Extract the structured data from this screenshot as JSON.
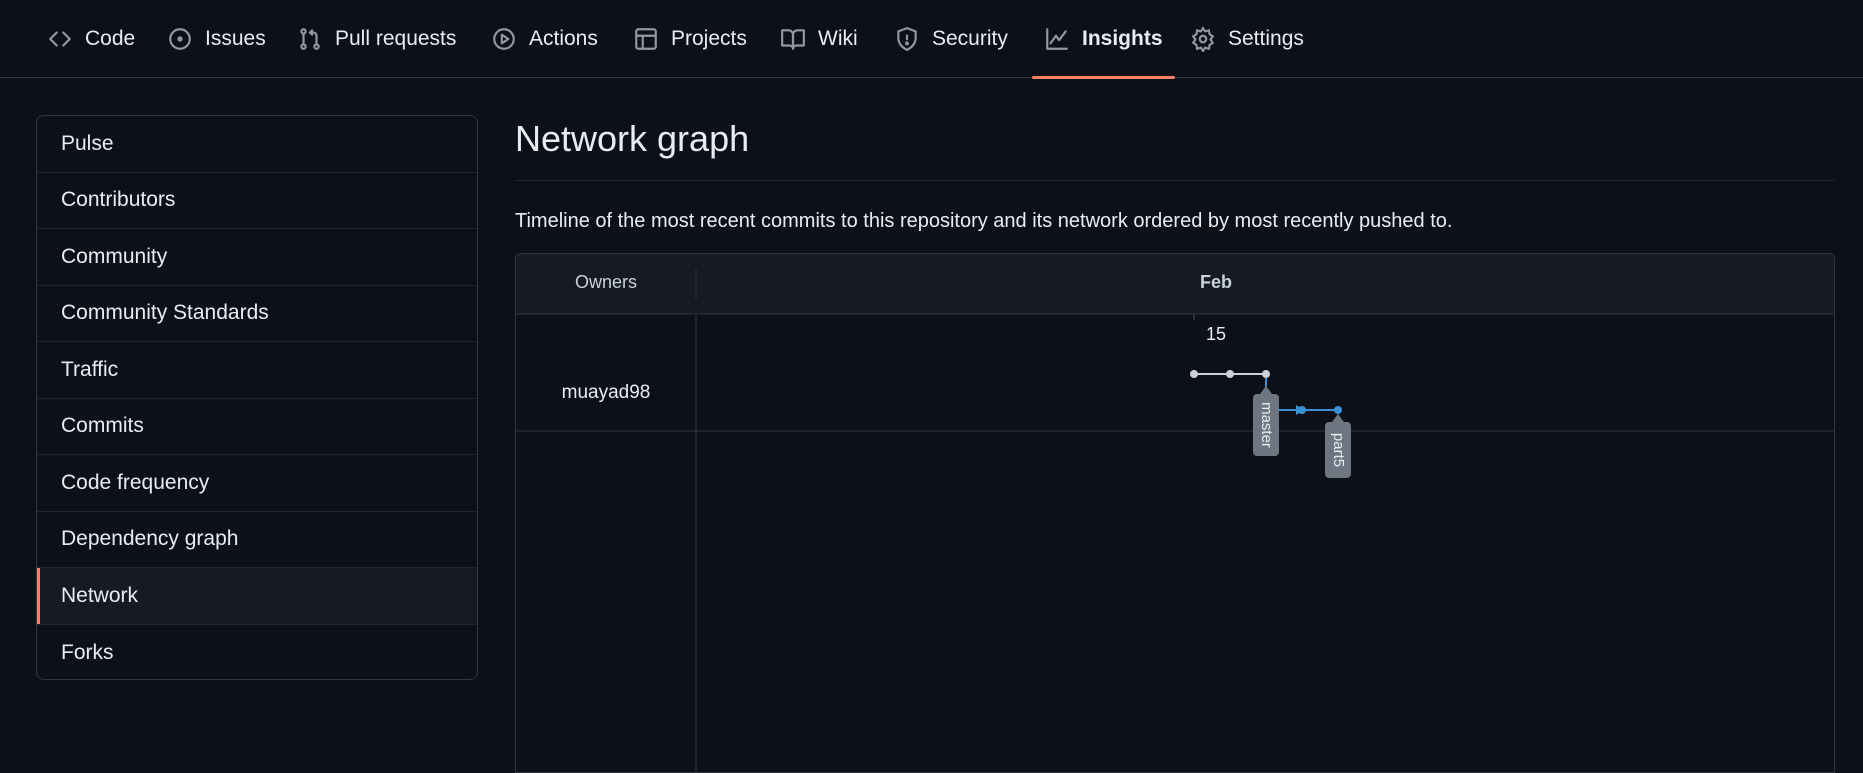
{
  "nav": {
    "tabs": [
      {
        "label": "Code",
        "icon": "code-icon"
      },
      {
        "label": "Issues",
        "icon": "issue-opened-icon"
      },
      {
        "label": "Pull requests",
        "icon": "git-pull-request-icon"
      },
      {
        "label": "Actions",
        "icon": "play-icon"
      },
      {
        "label": "Projects",
        "icon": "table-icon"
      },
      {
        "label": "Wiki",
        "icon": "book-icon"
      },
      {
        "label": "Security",
        "icon": "shield-icon"
      },
      {
        "label": "Insights",
        "icon": "graph-icon",
        "active": true
      },
      {
        "label": "Settings",
        "icon": "gear-icon"
      }
    ]
  },
  "sidebar": {
    "items": [
      {
        "label": "Pulse"
      },
      {
        "label": "Contributors"
      },
      {
        "label": "Community"
      },
      {
        "label": "Community Standards"
      },
      {
        "label": "Traffic"
      },
      {
        "label": "Commits"
      },
      {
        "label": "Code frequency"
      },
      {
        "label": "Dependency graph"
      },
      {
        "label": "Network",
        "selected": true
      },
      {
        "label": "Forks"
      }
    ]
  },
  "main": {
    "title": "Network graph",
    "description": "Timeline of the most recent commits to this repository and its network ordered by most recently pushed to."
  },
  "graph": {
    "owners_header": "Owners",
    "month_label": "Feb",
    "day_label": "15",
    "owner": "muayad98",
    "branches": [
      {
        "name": "master",
        "commits": 3,
        "color": "#c9d1d9"
      },
      {
        "name": "part5",
        "commits": 2,
        "color": "#3b8fd4"
      }
    ]
  },
  "colors": {
    "accent": "#f78166",
    "background": "#0d1117",
    "border": "#30363d"
  }
}
